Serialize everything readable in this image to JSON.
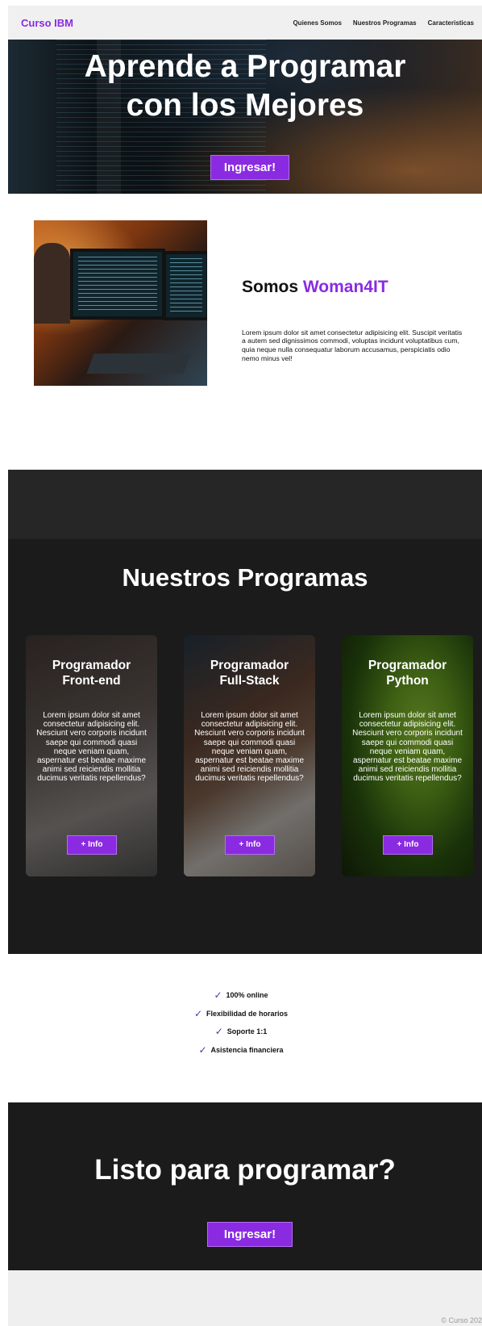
{
  "nav": {
    "brand": "Curso IBM",
    "links": [
      "Quienes Somos",
      "Nuestros Programas",
      "Caracteristicas"
    ]
  },
  "hero": {
    "title_line1": "Aprende a Programar",
    "title_line2": "con los Mejores",
    "button": "Ingresar!"
  },
  "about": {
    "title_prefix": "Somos",
    "title_accent": "Woman4IT",
    "text": "Lorem ipsum dolor sit amet consectetur adipisicing elit. Suscipit veritatis a autem sed dignissimos commodi, voluptas incidunt voluptatibus cum, quia neque nulla consequatur laborum accusamus, perspiciatis odio nemo minus vel!"
  },
  "programs": {
    "title": "Nuestros Programas",
    "cards": [
      {
        "title_line1": "Programador",
        "title_line2": "Front-end",
        "text": "Lorem ipsum dolor sit amet consectetur adipisicing elit. Nesciunt vero corporis incidunt saepe qui commodi quasi neque veniam quam, aspernatur est beatae maxime animi sed reiciendis mollitia ducimus veritatis repellendus?",
        "button": "+ Info"
      },
      {
        "title_line1": "Programador",
        "title_line2": "Full-Stack",
        "text": "Lorem ipsum dolor sit amet consectetur adipisicing elit. Nesciunt vero corporis incidunt saepe qui commodi quasi neque veniam quam, aspernatur est beatae maxime animi sed reiciendis mollitia ducimus veritatis repellendus?",
        "button": "+ Info"
      },
      {
        "title_line1": "Programador",
        "title_line2": "Python",
        "text": "Lorem ipsum dolor sit amet consectetur adipisicing elit. Nesciunt vero corporis incidunt saepe qui commodi quasi neque veniam quam, aspernatur est beatae maxime animi sed reiciendis mollitia ducimus veritatis repellendus?",
        "button": "+ Info"
      }
    ]
  },
  "features": {
    "check_icon": "✓",
    "items": [
      "100% online",
      "Flexibilidad de horarios",
      "Soporte 1:1",
      "Asistencia financiera"
    ]
  },
  "cta": {
    "title": "Listo para programar?",
    "button": "Ingresar!"
  },
  "footer": {
    "text": "© Curso 202"
  },
  "colors": {
    "accent": "#8a2be2",
    "dark_section": "#1b1b1b",
    "nav_bg": "#f0f0f0"
  }
}
